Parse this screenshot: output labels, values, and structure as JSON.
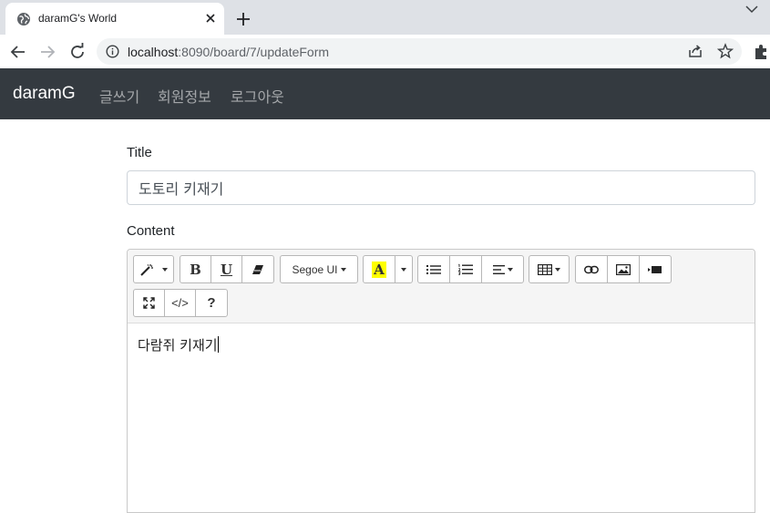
{
  "browser": {
    "tab_title": "daramG's World",
    "url_host": "localhost",
    "url_path": ":8090/board/7/updateForm"
  },
  "navbar": {
    "brand": "daramG",
    "links": [
      "글쓰기",
      "회원정보",
      "로그아웃"
    ]
  },
  "form": {
    "title_label": "Title",
    "title_value": "도토리 키재기",
    "content_label": "Content",
    "content_value": "다람쥐 키재기"
  },
  "editor_toolbar": {
    "font_name": "Segoe UI",
    "highlight_letter": "A",
    "bold_letter": "B",
    "underline_letter": "U",
    "codeview_label": "</>",
    "help_label": "?"
  },
  "colors": {
    "navbar_bg": "#343a40",
    "tabstrip_bg": "#dee1e6",
    "highlight_yellow": "#ffff00"
  }
}
